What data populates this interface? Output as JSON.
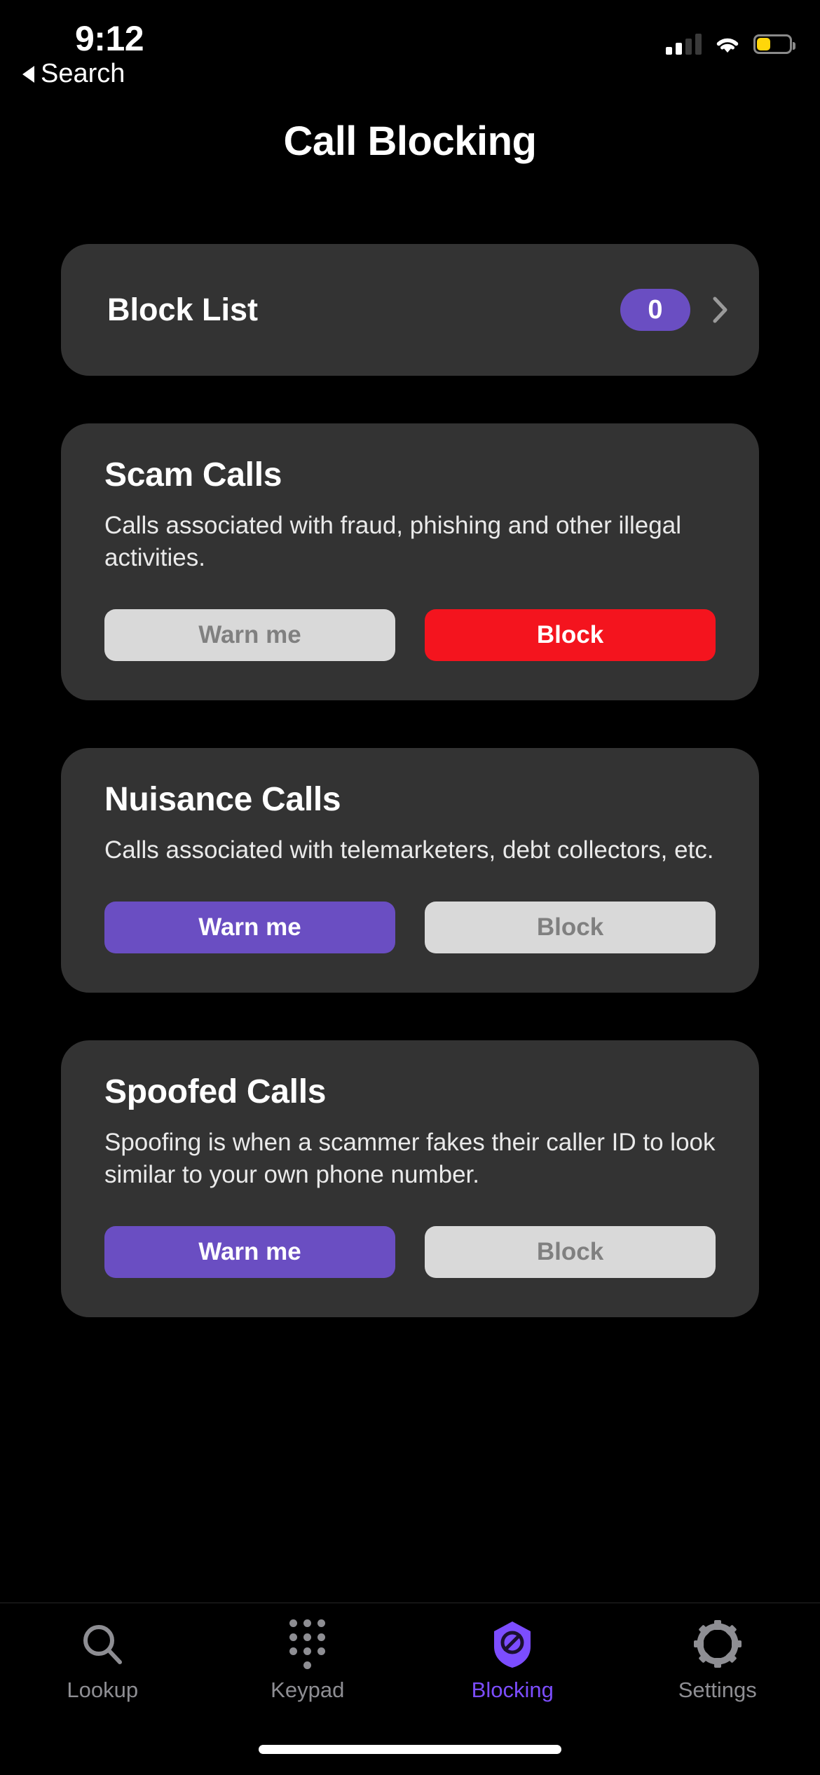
{
  "status_bar": {
    "time": "9:12",
    "signal_icon": "cellular-signal-icon",
    "signal_bars_filled": 2,
    "signal_bars_total": 4,
    "wifi_icon": "wifi-icon",
    "battery_icon": "battery-icon",
    "battery_level_percent": 38,
    "battery_color": "#FFD60A"
  },
  "back_link": {
    "label": "Search",
    "icon": "back-caret-icon"
  },
  "header": {
    "title": "Call Blocking"
  },
  "block_list": {
    "title": "Block List",
    "count": "0",
    "badge_color": "#6A4EC2",
    "chevron_icon": "chevron-right-icon"
  },
  "sections": [
    {
      "title": "Scam Calls",
      "description": "Calls associated with fraud, phishing and other illegal activities.",
      "warn_label": "Warn me",
      "block_label": "Block",
      "selected": "block"
    },
    {
      "title": "Nuisance Calls",
      "description": "Calls associated with telemarketers, debt collectors, etc.",
      "warn_label": "Warn me",
      "block_label": "Block",
      "selected": "warn"
    },
    {
      "title": "Spoofed Calls",
      "description": "Spoofing is when a scammer fakes their caller ID to look similar to your own phone number.",
      "warn_label": "Warn me",
      "block_label": "Block",
      "selected": "warn"
    }
  ],
  "tab_bar": {
    "active_color": "#7C4DFF",
    "inactive_color": "#8E8E93",
    "tabs": [
      {
        "label": "Lookup",
        "icon": "search-icon",
        "active": false
      },
      {
        "label": "Keypad",
        "icon": "keypad-icon",
        "active": false
      },
      {
        "label": "Blocking",
        "icon": "shield-block-icon",
        "active": true
      },
      {
        "label": "Settings",
        "icon": "gear-icon",
        "active": false
      }
    ]
  },
  "colors": {
    "background": "#000000",
    "card": "#333333",
    "accent_purple": "#6A4EC2",
    "danger_red": "#F4141E",
    "inactive_button": "#D9D9D9"
  }
}
